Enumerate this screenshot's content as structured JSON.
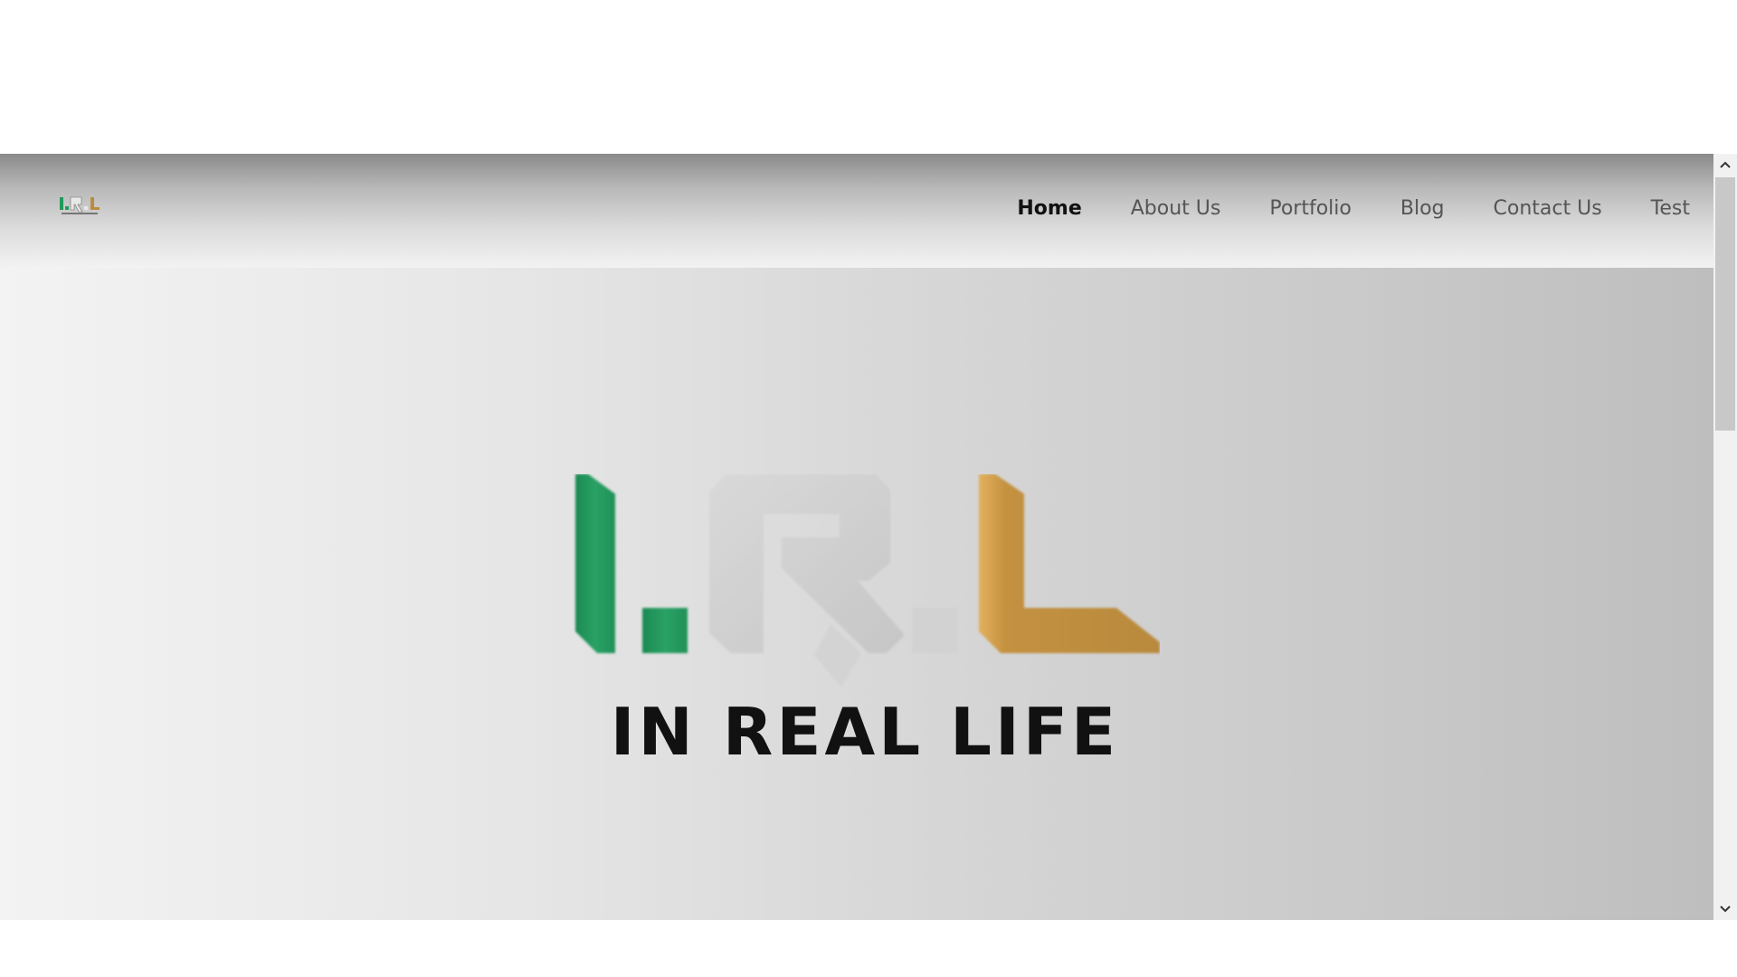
{
  "site": {
    "logo_text": "I.R.L",
    "tagline": "IN REAL LIFE",
    "brand_colors": {
      "green": "#23995d",
      "silver": "#cfcfcf",
      "gold": "#bd8b3f",
      "black": "#111111"
    }
  },
  "nav": {
    "items": [
      {
        "label": "Home",
        "active": true
      },
      {
        "label": "About Us",
        "active": false
      },
      {
        "label": "Portfolio",
        "active": false
      },
      {
        "label": "Blog",
        "active": false
      },
      {
        "label": "Contact Us",
        "active": false
      },
      {
        "label": "Test",
        "active": false
      }
    ]
  },
  "icons": {
    "scroll_up": "chevron-up-icon",
    "scroll_down": "chevron-down-icon"
  }
}
